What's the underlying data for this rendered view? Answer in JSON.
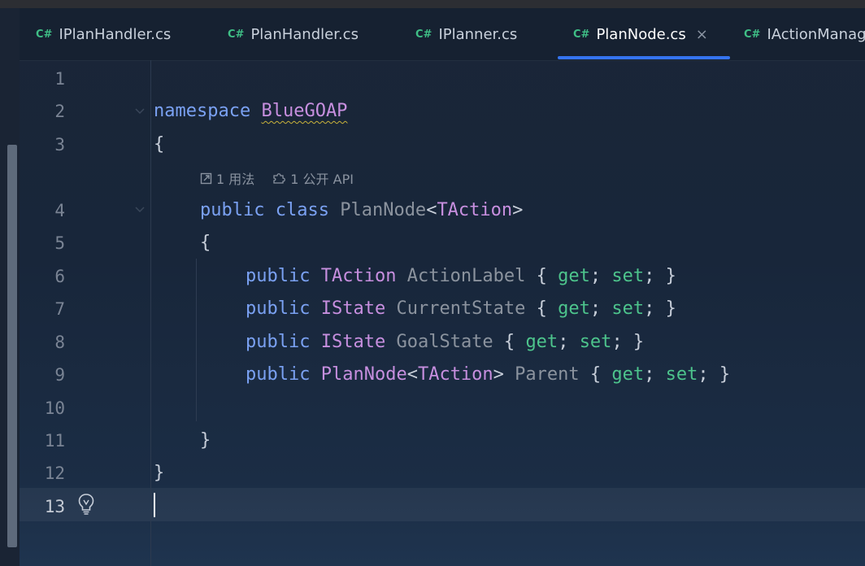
{
  "tabs": [
    {
      "lang": "C#",
      "name": "IPlanHandler.cs",
      "active": false
    },
    {
      "lang": "C#",
      "name": "PlanHandler.cs",
      "active": false
    },
    {
      "lang": "C#",
      "name": "IPlanner.cs",
      "active": false
    },
    {
      "lang": "C#",
      "name": "PlanNode.cs",
      "active": true,
      "close": "×"
    },
    {
      "lang": "C#",
      "name": "IActionManag",
      "active": false
    }
  ],
  "line_numbers": [
    "1",
    "2",
    "3",
    "4",
    "5",
    "6",
    "7",
    "8",
    "9",
    "10",
    "11",
    "12",
    "13"
  ],
  "current_line": "13",
  "hints": {
    "usages": "1 用法",
    "public_api": "1 公开 API"
  },
  "code": {
    "l2": {
      "kw": "namespace",
      "name": "BlueGOAP"
    },
    "l3": "{",
    "l4": {
      "kw1": "public",
      "kw2": "class",
      "name": "PlanNode",
      "lt": "<",
      "tparam": "TAction",
      "gt": ">"
    },
    "l5": "{",
    "props": [
      {
        "kw": "public",
        "type": "TAction",
        "generic": "",
        "name": "ActionLabel"
      },
      {
        "kw": "public",
        "type": "IState",
        "generic": "",
        "name": "CurrentState"
      },
      {
        "kw": "public",
        "type": "IState",
        "generic": "",
        "name": "GoalState"
      },
      {
        "kw": "public",
        "type": "PlanNode",
        "generic": "TAction",
        "name": "Parent"
      }
    ],
    "accessor_get": "get",
    "accessor_set": "set",
    "l11": "}",
    "l12": "}"
  },
  "colors": {
    "keyword": "#7aa1f2",
    "type": "#c78fdf",
    "identifier": "#8b939e",
    "accessor": "#4dc48c",
    "tab_accent": "#3574f0",
    "cs_badge": "#3fbf86"
  },
  "icons": {
    "usages": "external-link-icon",
    "public_api": "puzzle-icon",
    "intention": "lightbulb-icon",
    "fold": "chevron-down-icon"
  }
}
